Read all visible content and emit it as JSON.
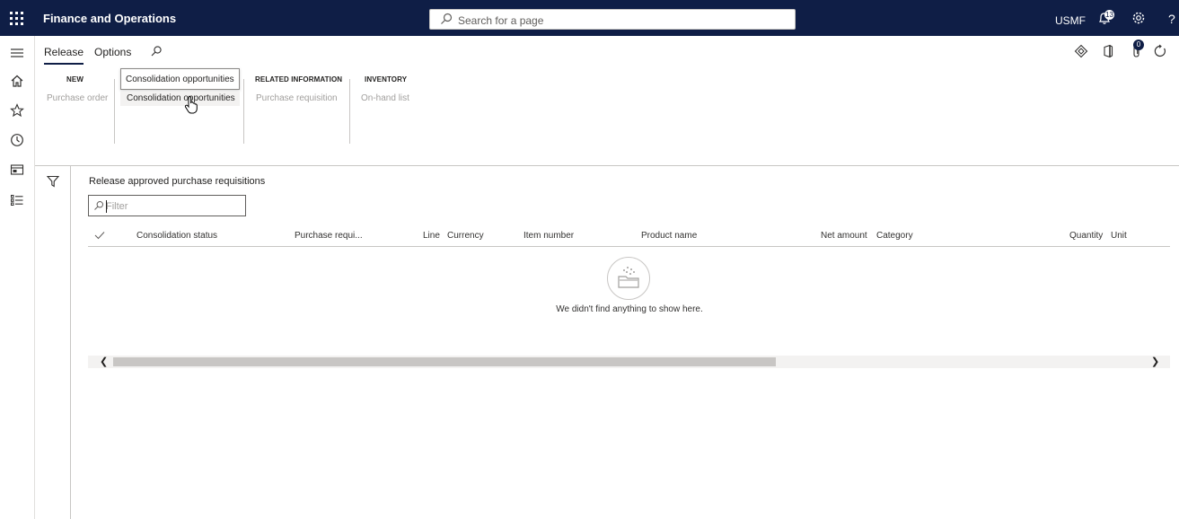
{
  "topbar": {
    "app_title": "Finance and Operations",
    "search_placeholder": "Search for a page",
    "company": "USMF",
    "notification_count": "13"
  },
  "actionpane": {
    "tabs": [
      {
        "label": "Release",
        "active": true
      },
      {
        "label": "Options",
        "active": false
      }
    ],
    "groups": [
      {
        "title": "New",
        "items": [
          "Purchase order"
        ]
      },
      {
        "title": "",
        "items": [
          "Consolidation opportunities"
        ]
      },
      {
        "title": "Related information",
        "items": [
          "Purchase requisition"
        ]
      },
      {
        "title": "Inventory",
        "items": [
          "On-hand list"
        ]
      }
    ],
    "tooltip": "Consolidation opportunities",
    "attachments_count": "0"
  },
  "page": {
    "title": "Release approved purchase requisitions",
    "filter_placeholder": "Filter"
  },
  "grid": {
    "columns": [
      "Consolidation status",
      "Purchase requi...",
      "Line",
      "Currency",
      "Item number",
      "Product name",
      "Net amount",
      "Category",
      "Quantity",
      "Unit"
    ],
    "empty_message": "We didn't find anything to show here."
  },
  "icons": {
    "waffle": "app-launcher-icon",
    "search": "search-icon",
    "bell": "notification-bell-icon",
    "gear": "settings-gear-icon",
    "help": "help-icon"
  },
  "colors": {
    "topbar": "#0f1e46",
    "border": "#c8c6c4"
  }
}
